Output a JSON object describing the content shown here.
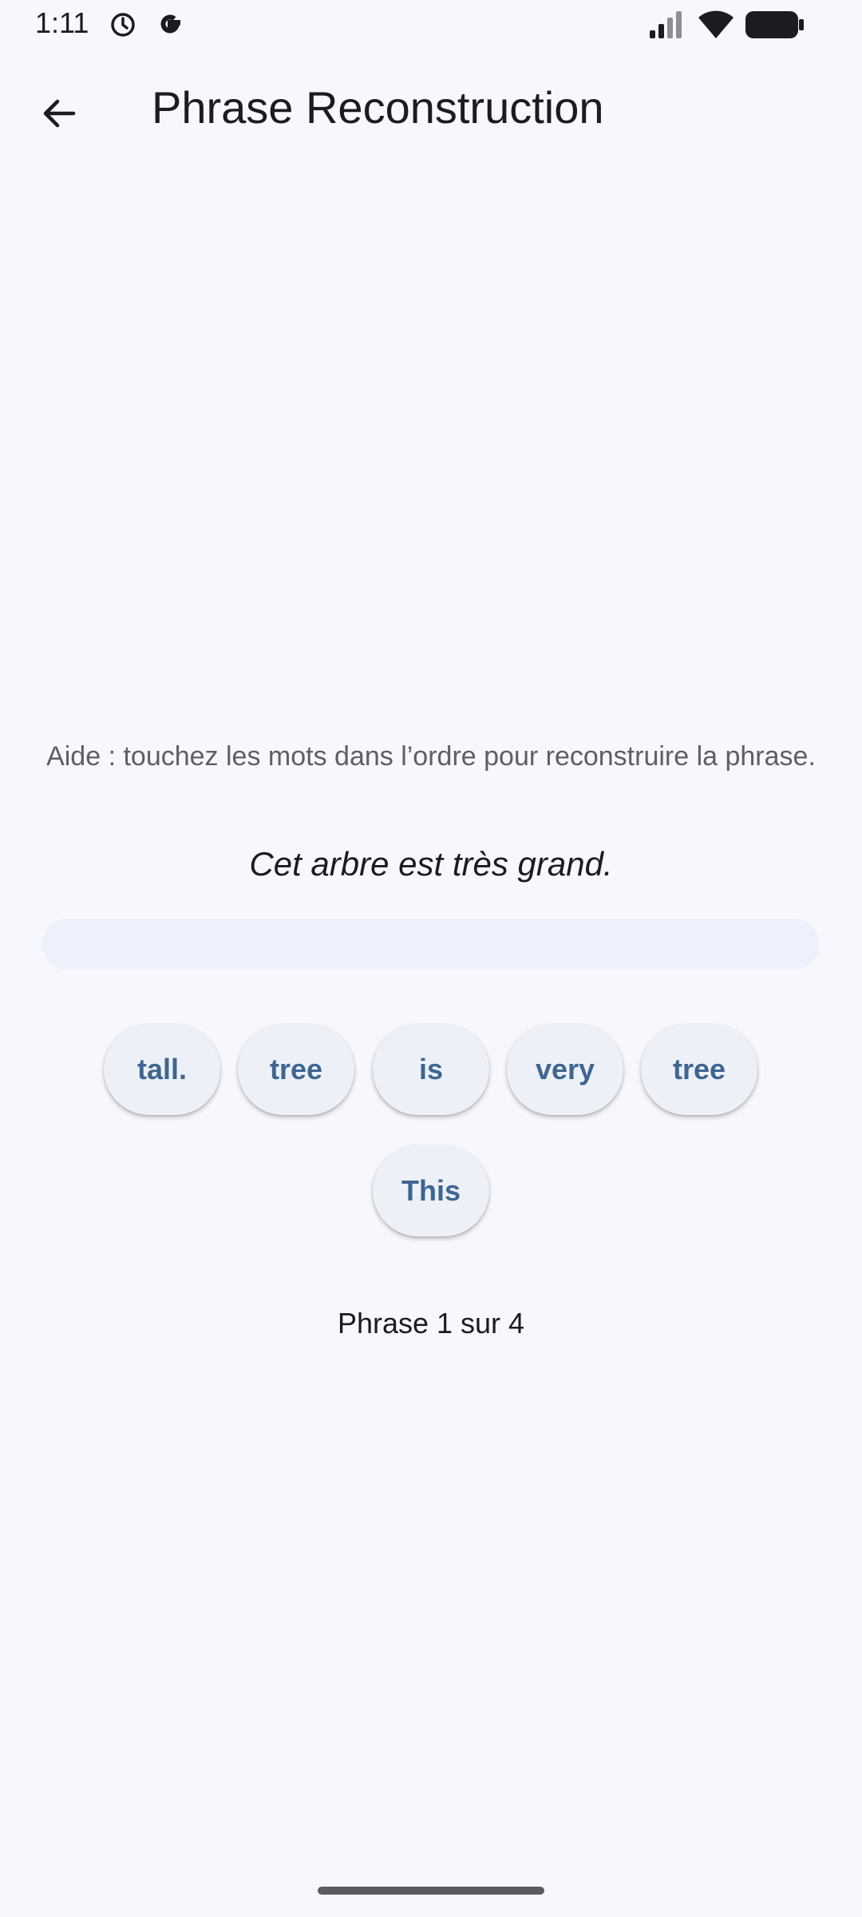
{
  "status_bar": {
    "time": "1:11",
    "icons": [
      "alarm-icon",
      "google-icon",
      "signal-icon",
      "wifi-icon",
      "battery-icon"
    ]
  },
  "app_bar": {
    "back_icon": "arrow-back-icon",
    "title": "Phrase Reconstruction"
  },
  "exercise": {
    "hint": "Aide : touchez les mots dans l’ordre pour reconstruire la phrase.",
    "source_sentence": "Cet arbre est très grand.",
    "answer_words": [],
    "word_options": [
      "tall.",
      "tree",
      "is",
      "very",
      "tree",
      "This"
    ],
    "progress": "Phrase 1 sur 4"
  },
  "colors": {
    "background": "#f7f8fd",
    "chip_background": "#eef0f8",
    "chip_text": "#3e6690",
    "answer_area": "#ecf1fb",
    "hint_text": "#5d5f66"
  }
}
